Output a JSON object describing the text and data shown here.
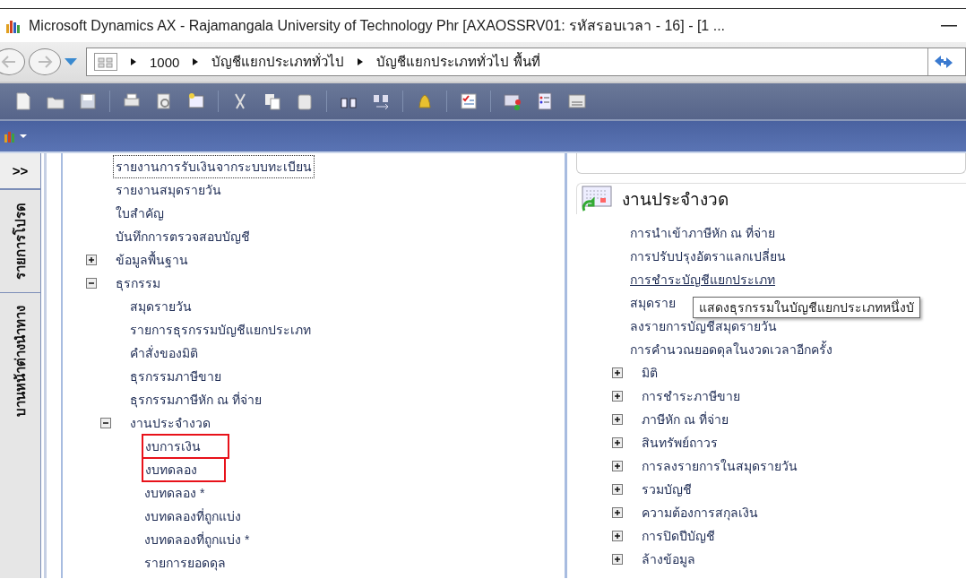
{
  "window": {
    "title": "Microsoft Dynamics AX - Rajamangala University of Technology Phr [AXAOSSRV01: รหัสรอบเวลา - 16] - [1 ..."
  },
  "breadcrumb": [
    "1000",
    "บัญชีแยกประเภททั่วไป",
    "บัญชีแยกประเภททั่วไป พื้นที่"
  ],
  "side_tabs": {
    "collapse": ">>",
    "tabs": [
      "รายการโปรด",
      "บานหน้าต่างนำทาง"
    ]
  },
  "tree": [
    {
      "label": "รายงานการรับเงินจากระบบทะเบียน",
      "focused": true
    },
    {
      "label": "รายงานสมุดรายวัน",
      "focused": false
    },
    {
      "label": "ใบสำคัญ",
      "focused": false
    },
    {
      "label": "บันทึกการตรวจสอบบัญชี",
      "focused": false
    },
    {
      "label": "ข้อมูลพื้นฐาน",
      "expanded": false
    },
    {
      "label": "ธุรกรรม",
      "expanded": true,
      "children": [
        {
          "label": "สมุดรายวัน"
        },
        {
          "label": "รายการธุรกรรมบัญชีแยกประเภท"
        },
        {
          "label": "คำสั่งของมิติ"
        },
        {
          "label": "ธุรกรรมภาษีขาย"
        },
        {
          "label": "ธุรกรรมภาษีหัก ณ ที่จ่าย"
        },
        {
          "label": "งานประจำงวด",
          "expanded": true,
          "children": [
            {
              "label": "งบการเงิน",
              "highlighted": true
            },
            {
              "label": "งบทดลอง",
              "highlighted": true
            },
            {
              "label": "งบทดลอง *",
              "highlighted": false
            },
            {
              "label": "งบทดลองที่ถูกแบ่ง",
              "highlighted": false
            },
            {
              "label": "งบทดลองที่ถูกแบ่ง *",
              "highlighted": false
            },
            {
              "label": "รายการยอดดุล",
              "highlighted": false
            }
          ]
        }
      ]
    }
  ],
  "group": {
    "title": "งานประจำงวด",
    "links": [
      {
        "label": "การนำเข้าภาษีหัก ณ ที่จ่าย",
        "hovered": false
      },
      {
        "label": "การปรับปรุงอัตราแลกเปลี่ยน",
        "hovered": false
      },
      {
        "label": "การชำระบัญชีแยกประเภท",
        "hovered": true
      },
      {
        "label": "สมุดราย",
        "hovered": false
      },
      {
        "label": "ลงรายการบัญชีสมุดรายวัน",
        "hovered": false
      },
      {
        "label": "การคำนวณยอดดุลในงวดเวลาอีกครั้ง",
        "hovered": false
      }
    ],
    "folders": [
      {
        "label": "มิติ",
        "expanded": false
      },
      {
        "label": "การชำระภาษีขาย",
        "expanded": false
      },
      {
        "label": "ภาษีหัก ณ ที่จ่าย",
        "expanded": false
      },
      {
        "label": "สินทรัพย์ถาวร",
        "expanded": false
      },
      {
        "label": "การลงรายการในสมุดรายวัน",
        "expanded": false
      },
      {
        "label": "รวมบัญชี",
        "expanded": false
      },
      {
        "label": "ความต้องการสกุลเงิน",
        "expanded": false
      },
      {
        "label": "การปิดปีบัญชี",
        "expanded": false
      },
      {
        "label": "ล้างข้อมูล",
        "expanded": false
      }
    ]
  },
  "tooltip": "แสดงธุรกรรมในบัญชีแยกประเภทหนึ่งบั"
}
